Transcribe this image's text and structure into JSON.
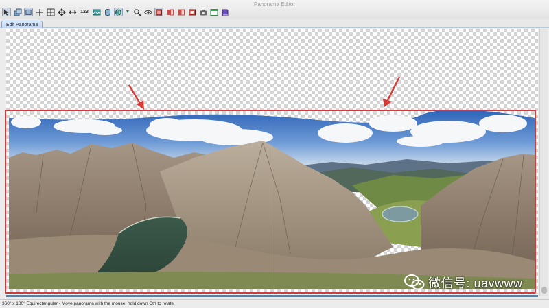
{
  "window": {
    "title": "Panorama Editor"
  },
  "toolbar": {
    "buttons": [
      {
        "icon": "select-tool-icon"
      },
      {
        "icon": "layers-icon"
      },
      {
        "icon": "crop-frame-icon"
      },
      {
        "icon": "crosshair-icon"
      },
      {
        "icon": "grid-icon"
      },
      {
        "icon": "move-icon"
      },
      {
        "icon": "straighten-icon"
      },
      {
        "icon": "numbers-icon",
        "label": "123"
      },
      {
        "icon": "panorama-view-icon"
      },
      {
        "icon": "cylinder-icon"
      },
      {
        "icon": "sphere-icon"
      },
      {
        "icon": "dropdown-arrow-icon"
      },
      {
        "icon": "zoom-icon"
      },
      {
        "icon": "eye-icon"
      },
      {
        "icon": "mask-icon"
      },
      {
        "icon": "flip-horizontal-icon"
      },
      {
        "icon": "flip-vertical-icon"
      },
      {
        "icon": "red-frame-icon"
      },
      {
        "icon": "camera-icon"
      },
      {
        "icon": "preview-window-icon"
      },
      {
        "icon": "book-icon"
      }
    ]
  },
  "tabs": [
    {
      "label": "Edit Panorama",
      "active": true
    }
  ],
  "status": {
    "text": "360° x 180° Equirectangular - Move panorama with the mouse, hold down Ctrl to rotate"
  },
  "watermark": {
    "text": "微信号: uavwww",
    "icon": "wechat-icon"
  },
  "colors": {
    "highlight": "#d53a36",
    "accent": "#5d7f9c",
    "tab": "#c4d7ef"
  }
}
